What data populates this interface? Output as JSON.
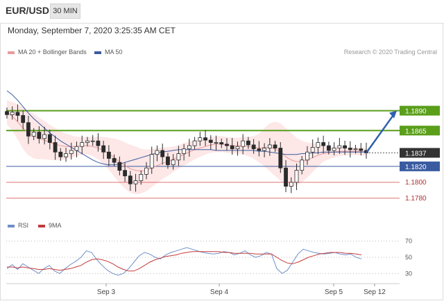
{
  "header": {
    "symbol": "EUR/USD",
    "timeframe": "30 MIN",
    "datetime": "Monday, September 7, 2020 3:25:35 AM CET"
  },
  "legend": {
    "ma20_label": "MA 20 + Bollinger Bands",
    "ma50_label": "MA 50",
    "credit": "Research © 2020 Trading Central",
    "rsi_label": "RSI",
    "ma9_label": "9MA"
  },
  "colors": {
    "bb": "#e99a9a",
    "bb_fill": "#fde3e3",
    "ma50": "#3a5ba0",
    "resistance": "#5a9e1a",
    "support_blue": "#3a5ba0",
    "support_red": "#e07070",
    "arrow": "#2f5fae",
    "rsi": "#6f8fc8",
    "rsi_ma": "#c43a3a",
    "current": "#333333",
    "candle": "#2b2b2b"
  },
  "chart_data": [
    {
      "type": "candlestick",
      "x_labels": [
        "Sep 3",
        "Sep 4",
        "Sep 5",
        "Sep 12"
      ],
      "ylim": [
        1.1765,
        1.1955
      ],
      "levels": [
        {
          "label": "1.1890",
          "value": 1.189,
          "kind": "resistance"
        },
        {
          "label": "1.1865",
          "value": 1.1865,
          "kind": "resistance"
        },
        {
          "label": "1.1837",
          "value": 1.1837,
          "kind": "current"
        },
        {
          "label": "1.1820",
          "value": 1.182,
          "kind": "support"
        },
        {
          "label": "1.1800",
          "value": 1.18,
          "kind": "minor"
        },
        {
          "label": "1.1780",
          "value": 1.178,
          "kind": "minor"
        }
      ],
      "projection": {
        "from": 1.1837,
        "to": 1.189
      },
      "price_path": [
        1.1885,
        1.1888,
        1.1884,
        1.1875,
        1.1858,
        1.1863,
        1.1855,
        1.186,
        1.185,
        1.1838,
        1.1832,
        1.1836,
        1.184,
        1.1845,
        1.185,
        1.1852,
        1.1852,
        1.1846,
        1.1838,
        1.183,
        1.1825,
        1.1815,
        1.1808,
        1.1798,
        1.1802,
        1.181,
        1.1818,
        1.1835,
        1.184,
        1.1832,
        1.1822,
        1.1828,
        1.1836,
        1.1842,
        1.1846,
        1.1852,
        1.1856,
        1.1853,
        1.185,
        1.185,
        1.1848,
        1.1846,
        1.1842,
        1.1845,
        1.1852,
        1.1847,
        1.1842,
        1.184,
        1.1843,
        1.1847,
        1.1843,
        1.1818,
        1.1795,
        1.18,
        1.1815,
        1.1828,
        1.1838,
        1.1844,
        1.185,
        1.1846,
        1.184,
        1.1843,
        1.1846,
        1.1843,
        1.1841,
        1.1842,
        1.184,
        1.1837
      ],
      "ma20": [
        1.1888,
        1.1883,
        1.1876,
        1.1868,
        1.1862,
        1.1858,
        1.1855,
        1.1853,
        1.185,
        1.1848,
        1.1846,
        1.1845,
        1.1845,
        1.1845,
        1.1846,
        1.1846,
        1.1845,
        1.1843,
        1.184,
        1.1836,
        1.1831,
        1.1826,
        1.1821,
        1.1817,
        1.1815,
        1.1814,
        1.1815,
        1.1818,
        1.1821,
        1.1824,
        1.1826,
        1.1829,
        1.1832,
        1.1835,
        1.1838,
        1.1841,
        1.1843,
        1.1845,
        1.1847,
        1.1848,
        1.1848,
        1.1847,
        1.1846,
        1.1846,
        1.1846,
        1.1845,
        1.1844,
        1.1843,
        1.1844,
        1.1844,
        1.1842,
        1.1838,
        1.1832,
        1.1828,
        1.1826,
        1.1826,
        1.1828,
        1.1831,
        1.1834,
        1.1836,
        1.1837,
        1.1838,
        1.1839,
        1.1839,
        1.1839,
        1.1839,
        1.1839,
        1.1838
      ],
      "bb_width": [
        0.0015,
        0.0018,
        0.0022,
        0.0026,
        0.0028,
        0.0028,
        0.0026,
        0.0024,
        0.0022,
        0.002,
        0.0018,
        0.0016,
        0.0014,
        0.0012,
        0.0011,
        0.0011,
        0.0012,
        0.0014,
        0.0017,
        0.002,
        0.0024,
        0.0027,
        0.0029,
        0.003,
        0.003,
        0.0028,
        0.0026,
        0.0024,
        0.0022,
        0.002,
        0.0018,
        0.0016,
        0.0015,
        0.0014,
        0.0013,
        0.0012,
        0.0011,
        0.001,
        0.001,
        0.001,
        0.001,
        0.001,
        0.001,
        0.001,
        0.0011,
        0.0012,
        0.0014,
        0.0018,
        0.0024,
        0.003,
        0.0034,
        0.0036,
        0.0036,
        0.0034,
        0.003,
        0.0026,
        0.0022,
        0.0018,
        0.0014,
        0.001,
        0.0008,
        0.0007,
        0.0006,
        0.0005,
        0.0005,
        0.0005,
        0.0005,
        0.0005
      ],
      "ma50": [
        1.1915,
        1.191,
        1.1903,
        1.1895,
        1.1887,
        1.188,
        1.1874,
        1.1868,
        1.1862,
        1.1857,
        1.1852,
        1.1848,
        1.1844,
        1.184,
        1.1836,
        1.1832,
        1.1828,
        1.1825,
        1.1823,
        1.1822,
        1.1822,
        1.1823,
        1.1825,
        1.1827,
        1.1829,
        1.1831,
        1.1833,
        1.1835,
        1.1837,
        1.1838,
        1.1839,
        1.184,
        1.1841,
        1.1841,
        1.1841,
        1.1841,
        1.1841,
        1.1841,
        1.1841,
        1.184,
        1.184,
        1.184,
        1.184,
        1.184,
        1.184,
        1.184,
        1.184,
        1.1839,
        1.1839,
        1.1838,
        1.1837,
        1.1836,
        1.1835,
        1.1835,
        1.1835,
        1.1836,
        1.1836,
        1.1837,
        1.1837,
        1.1838,
        1.1838,
        1.1838,
        1.1838,
        1.1838,
        1.1838,
        1.1838,
        1.1838,
        1.1838
      ]
    },
    {
      "type": "line",
      "x_labels": [
        "Sep 3",
        "Sep 4",
        "Sep 5",
        "Sep 12"
      ],
      "ylim": [
        20,
        80
      ],
      "y_ticks": [
        30,
        50,
        70
      ],
      "series": [
        {
          "name": "RSI",
          "values": [
            36,
            41,
            35,
            42,
            38,
            34,
            30,
            36,
            40,
            33,
            30,
            36,
            41,
            45,
            50,
            58,
            56,
            47,
            40,
            34,
            30,
            28,
            30,
            36,
            44,
            52,
            56,
            54,
            50,
            48,
            53,
            56,
            58,
            60,
            62,
            60,
            58,
            56,
            55,
            54,
            55,
            57,
            56,
            53,
            55,
            58,
            53,
            50,
            52,
            56,
            54,
            36,
            30,
            34,
            44,
            54,
            60,
            58,
            56,
            55,
            54,
            55,
            56,
            54,
            53,
            54,
            50,
            48
          ]
        },
        {
          "name": "9MA",
          "values": [
            38,
            38,
            37,
            38,
            37,
            36,
            35,
            35,
            36,
            35,
            34,
            35,
            36,
            38,
            40,
            44,
            47,
            48,
            47,
            45,
            42,
            38,
            35,
            33,
            33,
            36,
            40,
            44,
            47,
            49,
            51,
            52,
            53,
            55,
            56,
            57,
            57,
            57,
            57,
            57,
            57,
            56,
            56,
            55,
            55,
            55,
            55,
            54,
            54,
            54,
            54,
            50,
            46,
            43,
            42,
            44,
            47,
            50,
            52,
            54,
            55,
            56,
            56,
            56,
            55,
            55,
            54,
            53
          ]
        }
      ]
    }
  ]
}
